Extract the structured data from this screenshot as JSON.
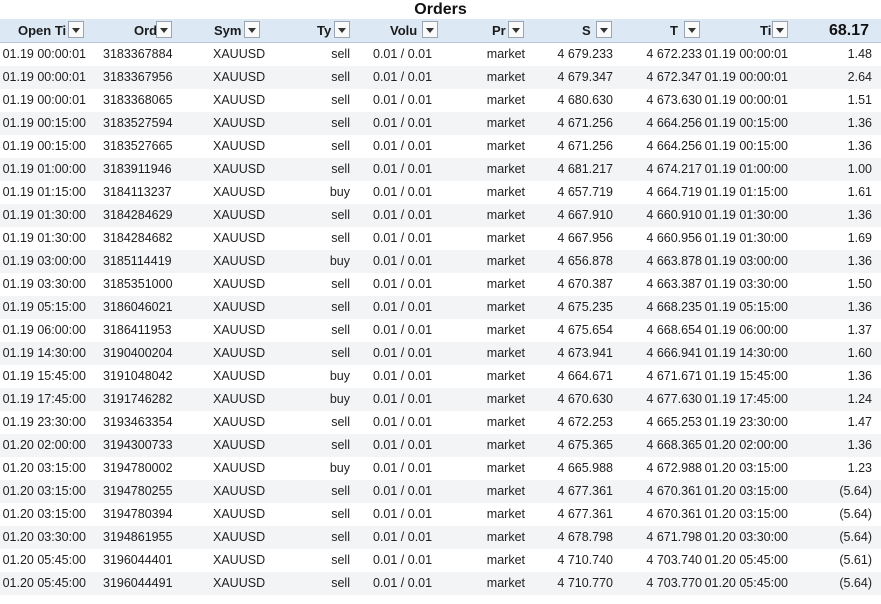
{
  "title": "Orders",
  "total": "68.17",
  "headers": {
    "open_time": "Open Ti",
    "order": "Ord",
    "symbol": "Sym",
    "type": "Ty",
    "volume": "Volu",
    "price": "Pr",
    "sl": "S",
    "tp": "T",
    "close_time": "Ti"
  },
  "rows": [
    {
      "open_time": "01.19 00:00:01",
      "order": "3183367884",
      "symbol": "XAUUSD",
      "type": "sell",
      "volume": "0.01 / 0.01",
      "price": "market",
      "sl": "4 679.233",
      "tp": "4 672.233",
      "close_time": "01.19 00:00:01",
      "profit": "1.48"
    },
    {
      "open_time": "01.19 00:00:01",
      "order": "3183367956",
      "symbol": "XAUUSD",
      "type": "sell",
      "volume": "0.01 / 0.01",
      "price": "market",
      "sl": "4 679.347",
      "tp": "4 672.347",
      "close_time": "01.19 00:00:01",
      "profit": "2.64"
    },
    {
      "open_time": "01.19 00:00:01",
      "order": "3183368065",
      "symbol": "XAUUSD",
      "type": "sell",
      "volume": "0.01 / 0.01",
      "price": "market",
      "sl": "4 680.630",
      "tp": "4 673.630",
      "close_time": "01.19 00:00:01",
      "profit": "1.51"
    },
    {
      "open_time": "01.19 00:15:00",
      "order": "3183527594",
      "symbol": "XAUUSD",
      "type": "sell",
      "volume": "0.01 / 0.01",
      "price": "market",
      "sl": "4 671.256",
      "tp": "4 664.256",
      "close_time": "01.19 00:15:00",
      "profit": "1.36"
    },
    {
      "open_time": "01.19 00:15:00",
      "order": "3183527665",
      "symbol": "XAUUSD",
      "type": "sell",
      "volume": "0.01 / 0.01",
      "price": "market",
      "sl": "4 671.256",
      "tp": "4 664.256",
      "close_time": "01.19 00:15:00",
      "profit": "1.36"
    },
    {
      "open_time": "01.19 01:00:00",
      "order": "3183911946",
      "symbol": "XAUUSD",
      "type": "sell",
      "volume": "0.01 / 0.01",
      "price": "market",
      "sl": "4 681.217",
      "tp": "4 674.217",
      "close_time": "01.19 01:00:00",
      "profit": "1.00"
    },
    {
      "open_time": "01.19 01:15:00",
      "order": "3184113237",
      "symbol": "XAUUSD",
      "type": "buy",
      "volume": "0.01 / 0.01",
      "price": "market",
      "sl": "4 657.719",
      "tp": "4 664.719",
      "close_time": "01.19 01:15:00",
      "profit": "1.61"
    },
    {
      "open_time": "01.19 01:30:00",
      "order": "3184284629",
      "symbol": "XAUUSD",
      "type": "sell",
      "volume": "0.01 / 0.01",
      "price": "market",
      "sl": "4 667.910",
      "tp": "4 660.910",
      "close_time": "01.19 01:30:00",
      "profit": "1.36"
    },
    {
      "open_time": "01.19 01:30:00",
      "order": "3184284682",
      "symbol": "XAUUSD",
      "type": "sell",
      "volume": "0.01 / 0.01",
      "price": "market",
      "sl": "4 667.956",
      "tp": "4 660.956",
      "close_time": "01.19 01:30:00",
      "profit": "1.69"
    },
    {
      "open_time": "01.19 03:00:00",
      "order": "3185114419",
      "symbol": "XAUUSD",
      "type": "buy",
      "volume": "0.01 / 0.01",
      "price": "market",
      "sl": "4 656.878",
      "tp": "4 663.878",
      "close_time": "01.19 03:00:00",
      "profit": "1.36"
    },
    {
      "open_time": "01.19 03:30:00",
      "order": "3185351000",
      "symbol": "XAUUSD",
      "type": "sell",
      "volume": "0.01 / 0.01",
      "price": "market",
      "sl": "4 670.387",
      "tp": "4 663.387",
      "close_time": "01.19 03:30:00",
      "profit": "1.50"
    },
    {
      "open_time": "01.19 05:15:00",
      "order": "3186046021",
      "symbol": "XAUUSD",
      "type": "sell",
      "volume": "0.01 / 0.01",
      "price": "market",
      "sl": "4 675.235",
      "tp": "4 668.235",
      "close_time": "01.19 05:15:00",
      "profit": "1.36"
    },
    {
      "open_time": "01.19 06:00:00",
      "order": "3186411953",
      "symbol": "XAUUSD",
      "type": "sell",
      "volume": "0.01 / 0.01",
      "price": "market",
      "sl": "4 675.654",
      "tp": "4 668.654",
      "close_time": "01.19 06:00:00",
      "profit": "1.37"
    },
    {
      "open_time": "01.19 14:30:00",
      "order": "3190400204",
      "symbol": "XAUUSD",
      "type": "sell",
      "volume": "0.01 / 0.01",
      "price": "market",
      "sl": "4 673.941",
      "tp": "4 666.941",
      "close_time": "01.19 14:30:00",
      "profit": "1.60"
    },
    {
      "open_time": "01.19 15:45:00",
      "order": "3191048042",
      "symbol": "XAUUSD",
      "type": "buy",
      "volume": "0.01 / 0.01",
      "price": "market",
      "sl": "4 664.671",
      "tp": "4 671.671",
      "close_time": "01.19 15:45:00",
      "profit": "1.36"
    },
    {
      "open_time": "01.19 17:45:00",
      "order": "3191746282",
      "symbol": "XAUUSD",
      "type": "buy",
      "volume": "0.01 / 0.01",
      "price": "market",
      "sl": "4 670.630",
      "tp": "4 677.630",
      "close_time": "01.19 17:45:00",
      "profit": "1.24"
    },
    {
      "open_time": "01.19 23:30:00",
      "order": "3193463354",
      "symbol": "XAUUSD",
      "type": "sell",
      "volume": "0.01 / 0.01",
      "price": "market",
      "sl": "4 672.253",
      "tp": "4 665.253",
      "close_time": "01.19 23:30:00",
      "profit": "1.47"
    },
    {
      "open_time": "01.20 02:00:00",
      "order": "3194300733",
      "symbol": "XAUUSD",
      "type": "sell",
      "volume": "0.01 / 0.01",
      "price": "market",
      "sl": "4 675.365",
      "tp": "4 668.365",
      "close_time": "01.20 02:00:00",
      "profit": "1.36"
    },
    {
      "open_time": "01.20 03:15:00",
      "order": "3194780002",
      "symbol": "XAUUSD",
      "type": "buy",
      "volume": "0.01 / 0.01",
      "price": "market",
      "sl": "4 665.988",
      "tp": "4 672.988",
      "close_time": "01.20 03:15:00",
      "profit": "1.23"
    },
    {
      "open_time": "01.20 03:15:00",
      "order": "3194780255",
      "symbol": "XAUUSD",
      "type": "sell",
      "volume": "0.01 / 0.01",
      "price": "market",
      "sl": "4 677.361",
      "tp": "4 670.361",
      "close_time": "01.20 03:15:00",
      "profit": "(5.64)"
    },
    {
      "open_time": "01.20 03:15:00",
      "order": "3194780394",
      "symbol": "XAUUSD",
      "type": "sell",
      "volume": "0.01 / 0.01",
      "price": "market",
      "sl": "4 677.361",
      "tp": "4 670.361",
      "close_time": "01.20 03:15:00",
      "profit": "(5.64)"
    },
    {
      "open_time": "01.20 03:30:00",
      "order": "3194861955",
      "symbol": "XAUUSD",
      "type": "sell",
      "volume": "0.01 / 0.01",
      "price": "market",
      "sl": "4 678.798",
      "tp": "4 671.798",
      "close_time": "01.20 03:30:00",
      "profit": "(5.64)"
    },
    {
      "open_time": "01.20 05:45:00",
      "order": "3196044401",
      "symbol": "XAUUSD",
      "type": "sell",
      "volume": "0.01 / 0.01",
      "price": "market",
      "sl": "4 710.740",
      "tp": "4 703.740",
      "close_time": "01.20 05:45:00",
      "profit": "(5.61)"
    },
    {
      "open_time": "01.20 05:45:00",
      "order": "3196044491",
      "symbol": "XAUUSD",
      "type": "sell",
      "volume": "0.01 / 0.01",
      "price": "market",
      "sl": "4 710.770",
      "tp": "4 703.770",
      "close_time": "01.20 05:45:00",
      "profit": "(5.64)"
    }
  ]
}
